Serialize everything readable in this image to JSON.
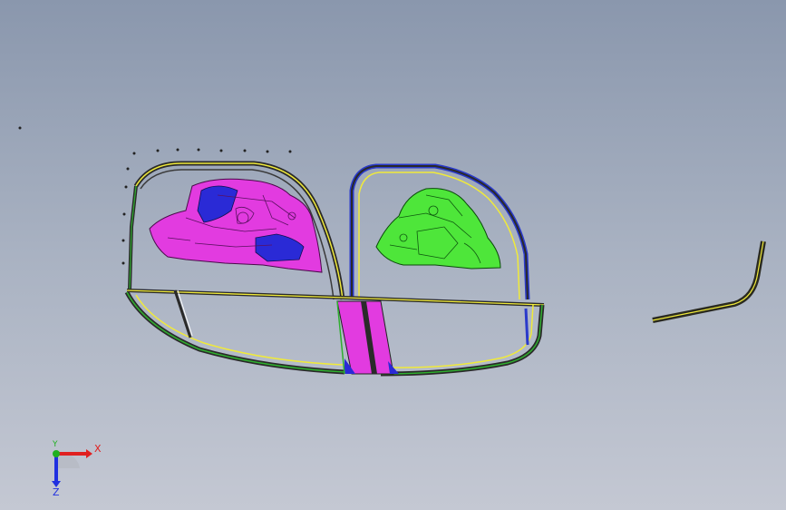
{
  "viewport": {
    "background_top": "#8a97ad",
    "background_bottom": "#c4c8d3"
  },
  "model": {
    "colors": {
      "frame_dark": "#2a2a2a",
      "frame_yellow": "#f0ea3a",
      "frame_green": "#2fae2f",
      "panel_left": "#e23be0",
      "panel_left_accent": "#2a2ad6",
      "panel_right": "#4ee63a",
      "pillar": "#e23be0",
      "pillar_blue": "#2a2ad6",
      "seal_frame_blue": "#2a3acb",
      "seal_strip": "#3a3a20"
    }
  },
  "triad": {
    "x_label": "X",
    "y_label": "Y",
    "z_label": "Z",
    "x_color": "#e02020",
    "y_color": "#20b020",
    "z_color": "#2030e0"
  }
}
